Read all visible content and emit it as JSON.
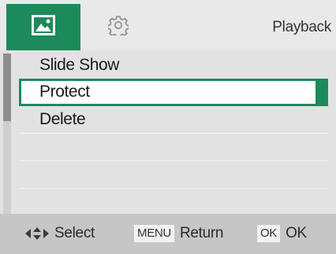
{
  "header": {
    "title": "Playback",
    "tabs": [
      {
        "icon": "playback-image-icon",
        "active": true
      },
      {
        "icon": "gear-icon",
        "active": false
      }
    ]
  },
  "menu": {
    "items": [
      {
        "label": "Slide Show",
        "selected": false
      },
      {
        "label": "Protect",
        "selected": true
      },
      {
        "label": "Delete",
        "selected": false
      },
      {
        "label": "",
        "selected": false
      },
      {
        "label": "",
        "selected": false
      },
      {
        "label": "",
        "selected": false
      }
    ]
  },
  "footer": {
    "select_label": "Select",
    "return_key": "MENU",
    "return_label": "Return",
    "ok_key": "OK",
    "ok_label": "OK"
  },
  "colors": {
    "accent": "#1c8a5b",
    "menu_bg": "#e2e2e2",
    "footer_bg": "#c6c6c6"
  }
}
